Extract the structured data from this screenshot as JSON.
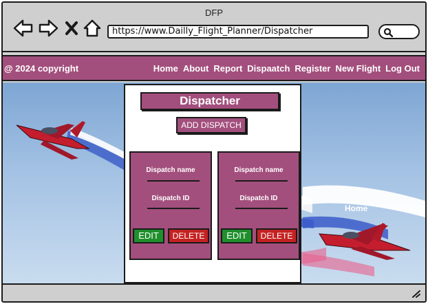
{
  "browser": {
    "title": "DFP",
    "url": "https://www.Dailly_Flight_Planner/Dispatcher",
    "nav_icons": [
      "back-arrow-icon",
      "forward-arrow-icon",
      "close-x-icon",
      "home-icon"
    ],
    "search_icon": "search-icon"
  },
  "navbar": {
    "copyright": "@ 2024 copyright",
    "links": [
      "Home",
      "About",
      "Report",
      "Dispaatch",
      "Register",
      "New Flight",
      "Log Out"
    ]
  },
  "hero": {
    "overlay_text": "Home"
  },
  "dispatcher": {
    "title": "Dispatcher",
    "add_button": "ADD DISPATCH",
    "cards": [
      {
        "name_label": "Dispatch name",
        "id_label": "Dispatch ID",
        "edit": "EDIT",
        "delete": "DELETE"
      },
      {
        "name_label": "Dispatch name",
        "id_label": "Dispatch ID",
        "edit": "EDIT",
        "delete": "DELETE"
      }
    ]
  },
  "colors": {
    "brand": "#a34f7d",
    "edit": "#1f8f2c",
    "delete": "#c42222",
    "chrome": "#cfcfcf"
  }
}
